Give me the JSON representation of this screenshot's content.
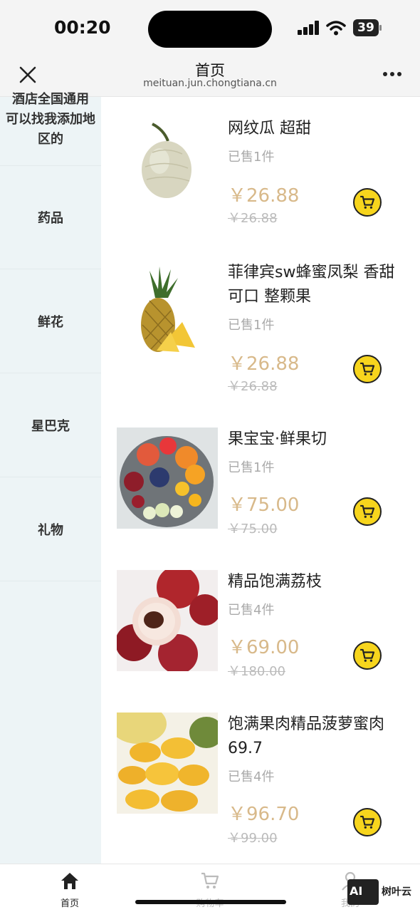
{
  "status": {
    "time": "00:20",
    "battery": "39"
  },
  "nav": {
    "title": "首页",
    "url": "meituan.jun.chongtiana.cn"
  },
  "sidebar": {
    "top_text_lines": [
      "酒店全国通用",
      "可以找我添加地",
      "区的"
    ],
    "items": [
      {
        "label": "药品"
      },
      {
        "label": "鲜花"
      },
      {
        "label": "星巴克"
      },
      {
        "label": "礼物"
      }
    ]
  },
  "products": [
    {
      "name": "网纹瓜 超甜",
      "sold": "已售1件",
      "price": "￥26.88",
      "original": "￥26.88"
    },
    {
      "name": "菲律宾sw蜂蜜凤梨 香甜可口 整颗果",
      "sold": "已售1件",
      "price": "￥26.88",
      "original": "￥26.88"
    },
    {
      "name": "果宝宝·鲜果切",
      "sold": "已售1件",
      "price": "￥75.00",
      "original": "￥75.00"
    },
    {
      "name": "精品饱满荔枝",
      "sold": "已售4件",
      "price": "￥69.00",
      "original": "￥180.00"
    },
    {
      "name": "饱满果肉精品菠萝蜜肉 69.7",
      "sold": "已售4件",
      "price": "￥96.70",
      "original": "￥99.00"
    }
  ],
  "tabs": [
    {
      "label": "首页",
      "icon": "home-icon"
    },
    {
      "label": "购物车",
      "icon": "cart-icon"
    },
    {
      "label": "我的",
      "icon": "user-icon"
    }
  ],
  "watermark": {
    "box": "AI",
    "text": "树叶云"
  },
  "colors": {
    "price": "#d8b98a",
    "cart_button": "#f7d51d",
    "sidebar_bg": "#edf4f6"
  }
}
